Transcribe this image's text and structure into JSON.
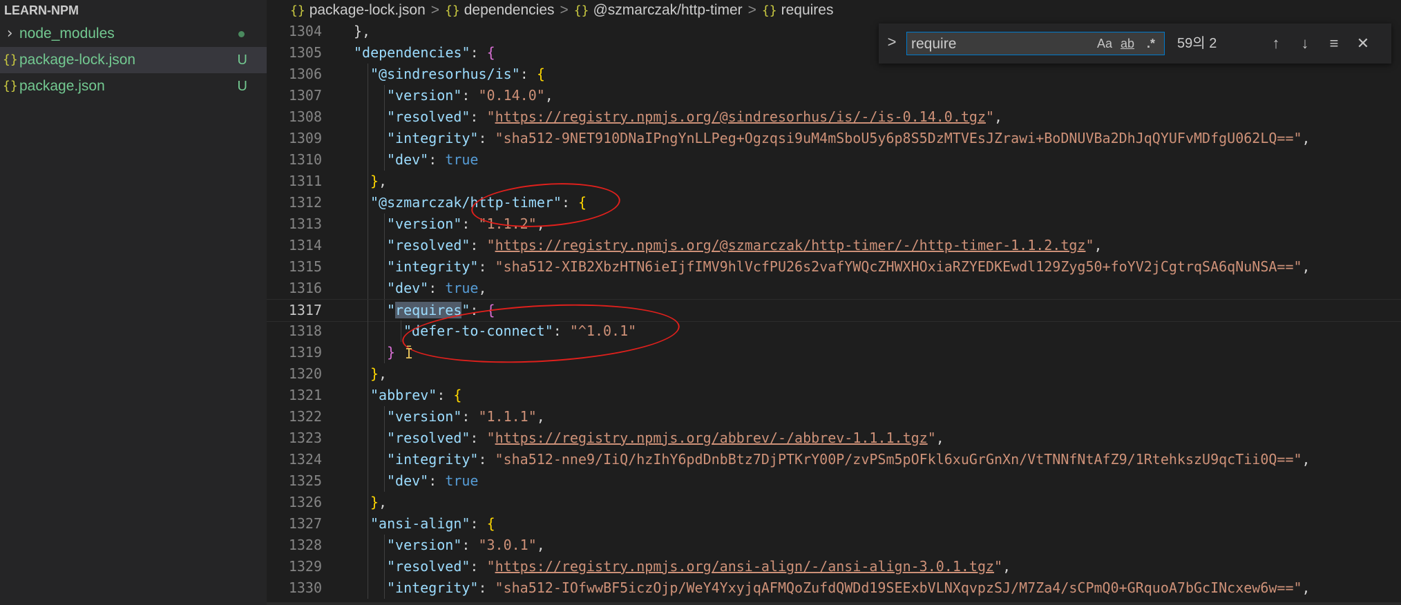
{
  "sidebar": {
    "title": "LEARN-NPM",
    "items": [
      {
        "icon": "chevron-right-icon",
        "glyph": "›",
        "label": "node_modules",
        "badge": ""
      },
      {
        "icon": "json-icon",
        "glyph": "{}",
        "label": "package-lock.json",
        "badge": "U"
      },
      {
        "icon": "json-icon",
        "glyph": "{}",
        "label": "package.json",
        "badge": "U"
      }
    ]
  },
  "breadcrumb": {
    "items": [
      "package-lock.json",
      "dependencies",
      "@szmarczak/http-timer",
      "requires"
    ],
    "glyph": "{}",
    "separator": ">"
  },
  "find": {
    "value": "require",
    "toggle_glyph": ">",
    "match_case": "Aa",
    "whole_word": "ab",
    "regex": ".*",
    "count": "59의 2",
    "prev_glyph": "↑",
    "next_glyph": "↓",
    "selection_glyph": "≡",
    "close_glyph": "✕"
  },
  "lines": [
    {
      "n": "1304",
      "level": 2,
      "tokens": [
        {
          "t": "pun",
          "v": "},"
        }
      ]
    },
    {
      "n": "1305",
      "level": 2,
      "tokens": [
        {
          "t": "key",
          "v": "\"dependencies\""
        },
        {
          "t": "pun",
          "v": ": "
        },
        {
          "t": "brace",
          "v": "{"
        }
      ]
    },
    {
      "n": "1306",
      "level": 3,
      "tokens": [
        {
          "t": "key",
          "v": "\"@sindresorhus/is\""
        },
        {
          "t": "pun",
          "v": ": "
        },
        {
          "t": "brace2",
          "v": "{"
        }
      ]
    },
    {
      "n": "1307",
      "level": 4,
      "tokens": [
        {
          "t": "key",
          "v": "\"version\""
        },
        {
          "t": "pun",
          "v": ": "
        },
        {
          "t": "str",
          "v": "\"0.14.0\""
        },
        {
          "t": "pun",
          "v": ","
        }
      ]
    },
    {
      "n": "1308",
      "level": 4,
      "tokens": [
        {
          "t": "key",
          "v": "\"resolved\""
        },
        {
          "t": "pun",
          "v": ": "
        },
        {
          "t": "str",
          "v": "\""
        },
        {
          "t": "url",
          "v": "https://registry.npmjs.org/@sindresorhus/is/-/is-0.14.0.tgz"
        },
        {
          "t": "str",
          "v": "\""
        },
        {
          "t": "pun",
          "v": ","
        }
      ]
    },
    {
      "n": "1309",
      "level": 4,
      "tokens": [
        {
          "t": "key",
          "v": "\"integrity\""
        },
        {
          "t": "pun",
          "v": ": "
        },
        {
          "t": "str",
          "v": "\"sha512-9NET910DNaIPngYnLLPeg+Ogzqsi9uM4mSboU5y6p8S5DzMTVEsJZrawi+BoDNUVBa2DhJqQYUFvMDfgU062LQ==\""
        },
        {
          "t": "pun",
          "v": ","
        }
      ]
    },
    {
      "n": "1310",
      "level": 4,
      "tokens": [
        {
          "t": "key",
          "v": "\"dev\""
        },
        {
          "t": "pun",
          "v": ": "
        },
        {
          "t": "bool",
          "v": "true"
        }
      ]
    },
    {
      "n": "1311",
      "level": 3,
      "tokens": [
        {
          "t": "brace2",
          "v": "}"
        },
        {
          "t": "pun",
          "v": ","
        }
      ]
    },
    {
      "n": "1312",
      "level": 3,
      "tokens": [
        {
          "t": "key",
          "v": "\"@szmarczak/http-timer\""
        },
        {
          "t": "pun",
          "v": ": "
        },
        {
          "t": "brace2",
          "v": "{"
        }
      ]
    },
    {
      "n": "1313",
      "level": 4,
      "tokens": [
        {
          "t": "key",
          "v": "\"version\""
        },
        {
          "t": "pun",
          "v": ": "
        },
        {
          "t": "str",
          "v": "\"1.1.2\""
        },
        {
          "t": "pun",
          "v": ","
        }
      ]
    },
    {
      "n": "1314",
      "level": 4,
      "tokens": [
        {
          "t": "key",
          "v": "\"resolved\""
        },
        {
          "t": "pun",
          "v": ": "
        },
        {
          "t": "str",
          "v": "\""
        },
        {
          "t": "url",
          "v": "https://registry.npmjs.org/@szmarczak/http-timer/-/http-timer-1.1.2.tgz"
        },
        {
          "t": "str",
          "v": "\""
        },
        {
          "t": "pun",
          "v": ","
        }
      ]
    },
    {
      "n": "1315",
      "level": 4,
      "tokens": [
        {
          "t": "key",
          "v": "\"integrity\""
        },
        {
          "t": "pun",
          "v": ": "
        },
        {
          "t": "str",
          "v": "\"sha512-XIB2XbzHTN6ieIjfIMV9hlVcfPU26s2vafYWQcZHWXHOxiaRZYEDKEwdl129Zyg50+foYV2jCgtrqSA6qNuNSA==\""
        },
        {
          "t": "pun",
          "v": ","
        }
      ]
    },
    {
      "n": "1316",
      "level": 4,
      "tokens": [
        {
          "t": "key",
          "v": "\"dev\""
        },
        {
          "t": "pun",
          "v": ": "
        },
        {
          "t": "bool",
          "v": "true"
        },
        {
          "t": "pun",
          "v": ","
        }
      ]
    },
    {
      "n": "1317",
      "level": 4,
      "current": true,
      "tokens": [
        {
          "t": "key",
          "v": "\""
        },
        {
          "t": "keyhl",
          "v": "requires"
        },
        {
          "t": "key",
          "v": "\""
        },
        {
          "t": "pun",
          "v": ": "
        },
        {
          "t": "brace",
          "v": "{"
        }
      ]
    },
    {
      "n": "1318",
      "level": 5,
      "tokens": [
        {
          "t": "key",
          "v": "\"defer-to-connect\""
        },
        {
          "t": "pun",
          "v": ": "
        },
        {
          "t": "str",
          "v": "\"^1.0.1\""
        }
      ]
    },
    {
      "n": "1319",
      "level": 4,
      "tokens": [
        {
          "t": "brace",
          "v": "}"
        }
      ]
    },
    {
      "n": "1320",
      "level": 3,
      "tokens": [
        {
          "t": "brace2",
          "v": "}"
        },
        {
          "t": "pun",
          "v": ","
        }
      ]
    },
    {
      "n": "1321",
      "level": 3,
      "tokens": [
        {
          "t": "key",
          "v": "\"abbrev\""
        },
        {
          "t": "pun",
          "v": ": "
        },
        {
          "t": "brace2",
          "v": "{"
        }
      ]
    },
    {
      "n": "1322",
      "level": 4,
      "tokens": [
        {
          "t": "key",
          "v": "\"version\""
        },
        {
          "t": "pun",
          "v": ": "
        },
        {
          "t": "str",
          "v": "\"1.1.1\""
        },
        {
          "t": "pun",
          "v": ","
        }
      ]
    },
    {
      "n": "1323",
      "level": 4,
      "tokens": [
        {
          "t": "key",
          "v": "\"resolved\""
        },
        {
          "t": "pun",
          "v": ": "
        },
        {
          "t": "str",
          "v": "\""
        },
        {
          "t": "url",
          "v": "https://registry.npmjs.org/abbrev/-/abbrev-1.1.1.tgz"
        },
        {
          "t": "str",
          "v": "\""
        },
        {
          "t": "pun",
          "v": ","
        }
      ]
    },
    {
      "n": "1324",
      "level": 4,
      "tokens": [
        {
          "t": "key",
          "v": "\"integrity\""
        },
        {
          "t": "pun",
          "v": ": "
        },
        {
          "t": "str",
          "v": "\"sha512-nne9/IiQ/hzIhY6pdDnbBtz7DjPTKrY00P/zvPSm5pOFkl6xuGrGnXn/VtTNNfNtAfZ9/1RtehkszU9qcTii0Q==\""
        },
        {
          "t": "pun",
          "v": ","
        }
      ]
    },
    {
      "n": "1325",
      "level": 4,
      "tokens": [
        {
          "t": "key",
          "v": "\"dev\""
        },
        {
          "t": "pun",
          "v": ": "
        },
        {
          "t": "bool",
          "v": "true"
        }
      ]
    },
    {
      "n": "1326",
      "level": 3,
      "tokens": [
        {
          "t": "brace2",
          "v": "}"
        },
        {
          "t": "pun",
          "v": ","
        }
      ]
    },
    {
      "n": "1327",
      "level": 3,
      "tokens": [
        {
          "t": "key",
          "v": "\"ansi-align\""
        },
        {
          "t": "pun",
          "v": ": "
        },
        {
          "t": "brace2",
          "v": "{"
        }
      ]
    },
    {
      "n": "1328",
      "level": 4,
      "tokens": [
        {
          "t": "key",
          "v": "\"version\""
        },
        {
          "t": "pun",
          "v": ": "
        },
        {
          "t": "str",
          "v": "\"3.0.1\""
        },
        {
          "t": "pun",
          "v": ","
        }
      ]
    },
    {
      "n": "1329",
      "level": 4,
      "tokens": [
        {
          "t": "key",
          "v": "\"resolved\""
        },
        {
          "t": "pun",
          "v": ": "
        },
        {
          "t": "str",
          "v": "\""
        },
        {
          "t": "url",
          "v": "https://registry.npmjs.org/ansi-align/-/ansi-align-3.0.1.tgz"
        },
        {
          "t": "str",
          "v": "\""
        },
        {
          "t": "pun",
          "v": ","
        }
      ]
    },
    {
      "n": "1330",
      "level": 4,
      "tokens": [
        {
          "t": "key",
          "v": "\"integrity\""
        },
        {
          "t": "pun",
          "v": ": "
        },
        {
          "t": "str",
          "v": "\"sha512-IOfwwBF5iczOjp/WeY4YxyjqAFMQoZufdQWDd19SEExbVLNXqvpzSJ/M7Za4/sCPmQ0+GRquoA7bGcINcxew6w==\""
        },
        {
          "t": "pun",
          "v": ","
        }
      ]
    }
  ]
}
